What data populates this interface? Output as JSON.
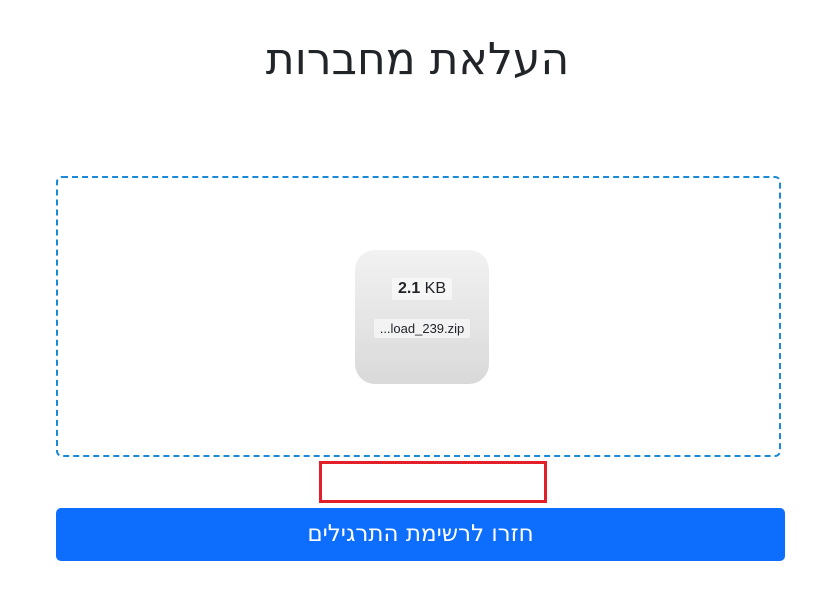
{
  "page": {
    "title": "העלאת מחברות"
  },
  "dropzone": {
    "file": {
      "size_value": "2.1",
      "size_unit": "KB",
      "name": "...load_239.zip"
    }
  },
  "actions": {
    "back_label": "חזרו לרשימת התרגילים"
  },
  "colors": {
    "accent": "#0d6efd",
    "dropzone_border": "#1a8ad8",
    "error_outline": "#e3202a"
  }
}
